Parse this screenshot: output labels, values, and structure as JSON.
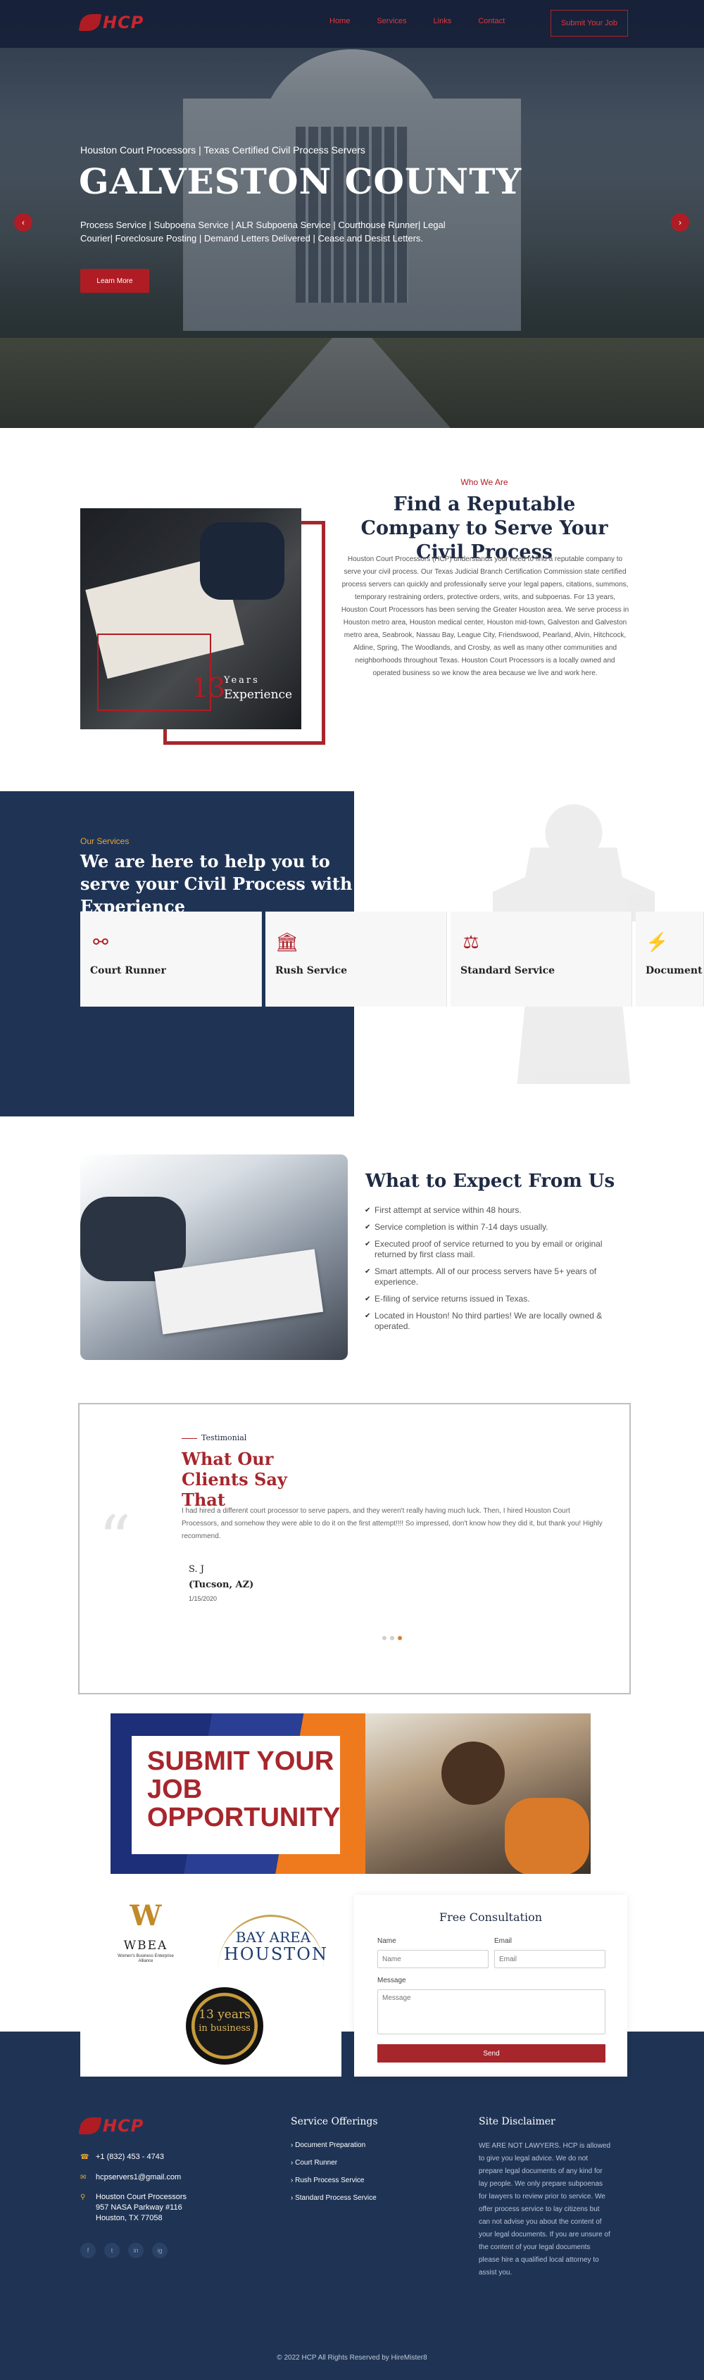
{
  "header": {
    "logo_text": "HCP",
    "nav": [
      "Home",
      "Services",
      "Links",
      "Contact"
    ],
    "cta": "Submit Your Job"
  },
  "hero": {
    "kicker": "Houston Court Processors | Texas Certified Civil Process Servers",
    "title": "GALVESTON COUNTY",
    "subtitle": "Process Service | Subpoena Service | ALR Subpoena Service | Courthouse Runner| Legal Courier| Foreclosure Posting | Demand Letters Delivered | Cease and Desist Letters.",
    "button": "Learn More",
    "prev": "‹",
    "next": "›"
  },
  "who": {
    "kicker": "Who We Are",
    "title": "Find a Reputable Company to Serve Your Civil Process",
    "years_number": "13",
    "years_label": "Years",
    "experience_label": "Experience",
    "body": "Houston Court Processors (HCP) understands your need to find a reputable company to serve your civil process. Our Texas Judicial Branch Certification Commission state certified process servers can quickly and professionally serve your legal papers, citations, summons, temporary restraining orders, protective orders, writs, and subpoenas. For 13 years, Houston Court Processors has been serving the Greater Houston area. We serve process in Houston metro area, Houston medical center, Houston mid-town, Galveston and Galveston metro area, Seabrook, Nassau Bay, League City, Friendswood, Pearland, Alvin, Hitchcock, Aldine, Spring, The Woodlands, and Crosby, as well as many other communities and neighborhoods throughout Texas. Houston Court Processors is a locally owned and operated business so we know the area because we live and work here."
  },
  "services": {
    "kicker": "Our Services",
    "title": "We are here to help you to serve your Civil Process with Experience",
    "items": [
      {
        "name": "Court Runner",
        "icon": "book-reader-icon"
      },
      {
        "name": "Rush Service",
        "icon": "courthouse-icon"
      },
      {
        "name": "Standard Service",
        "icon": "scales-icon"
      },
      {
        "name": "Document Preparation",
        "icon": "shield-bolt-icon"
      }
    ]
  },
  "expect": {
    "title": "What to Expect From Us",
    "items": [
      "First attempt at service within 48 hours.",
      "Service completion is within 7-14 days usually.",
      "Executed proof of service returned to you by email or original returned by first class mail.",
      "Smart attempts. All of our process servers have 5+ years of experience.",
      "E-filing of service returns issued in Texas.",
      "Located in Houston! No third parties! We are locally owned & operated."
    ]
  },
  "testimonial": {
    "kicker": "Testimonial",
    "title": "What Our Clients Say That",
    "quote_mark": "“",
    "text": "I had hired a different court processor to serve papers, and they weren't really having much luck. Then, I hired Houston Court Processors, and somehow they were able to do it on the first attempt!!!! So impressed, don't know how they did it, but thank you! Highly recommend.",
    "name": "S. J",
    "location": "(Tucson, AZ)",
    "date": "1/15/2020"
  },
  "banner": {
    "text": "SUBMIT YOUR JOB OPPORTUNITY"
  },
  "logos": {
    "wbea_letter": "W",
    "wbea_title": "WBEA",
    "wbea_sub": "Women's Business Enterprise Alliance",
    "bah_line1": "BAY AREA",
    "bah_line2": "HOUSTON",
    "seal_line1": "13 years",
    "seal_line2": "in business"
  },
  "form": {
    "title": "Free Consultation",
    "name_label": "Name",
    "name_placeholder": "Name",
    "email_label": "Email",
    "email_placeholder": "Email",
    "message_label": "Message",
    "message_placeholder": "Message",
    "send": "Send"
  },
  "footer": {
    "phone": "+1 (832) 453 - 4743",
    "email": "hcpservers1@gmail.com",
    "address": "Houston Court Processors 957 NASA Parkway #116 Houston, TX 77058",
    "social": [
      "f",
      "t",
      "in",
      "ig"
    ],
    "services_heading": "Service Offerings",
    "services_links": [
      "Document Preparation",
      "Court Runner",
      "Rush Process Service",
      "Standard Process Service"
    ],
    "disclaimer_heading": "Site Disclaimer",
    "disclaimer": "WE ARE NOT LAWYERS. HCP is allowed to give you legal advice. We do not prepare legal documents of any kind for lay people. We only prepare subpoenas for lawyers to review prior to service. We offer process service to lay citizens but can not advise you about the content of your legal documents. If you are unsure of the content of your legal documents please hire a qualified local attorney to assist you.",
    "copyright": "© 2022 HCP All Rights Reserved by HireMister8"
  },
  "colors": {
    "brand_red": "#b01c24",
    "navy": "#1f3455",
    "accent_orange": "#e6a43a"
  }
}
